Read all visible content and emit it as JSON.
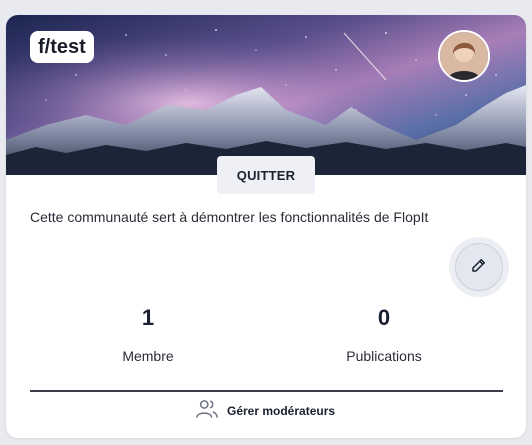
{
  "community": {
    "name": "f/test",
    "description": "Cette communauté sert à démontrer les fonctionnalités de FlopIt",
    "leave_label": "QUITTER"
  },
  "stats": [
    {
      "value": "1",
      "label": "Membre"
    },
    {
      "value": "0",
      "label": "Publications"
    }
  ],
  "actions": {
    "manage_moderators_label": "Gérer modérateurs"
  },
  "icons": {
    "edit": "pencil-icon",
    "manage_moderators": "users-icon"
  },
  "colors": {
    "page_background": "#e8eaf0",
    "card_background": "#ffffff",
    "button_background": "#eef0f5",
    "text_primary": "#1b2030"
  }
}
